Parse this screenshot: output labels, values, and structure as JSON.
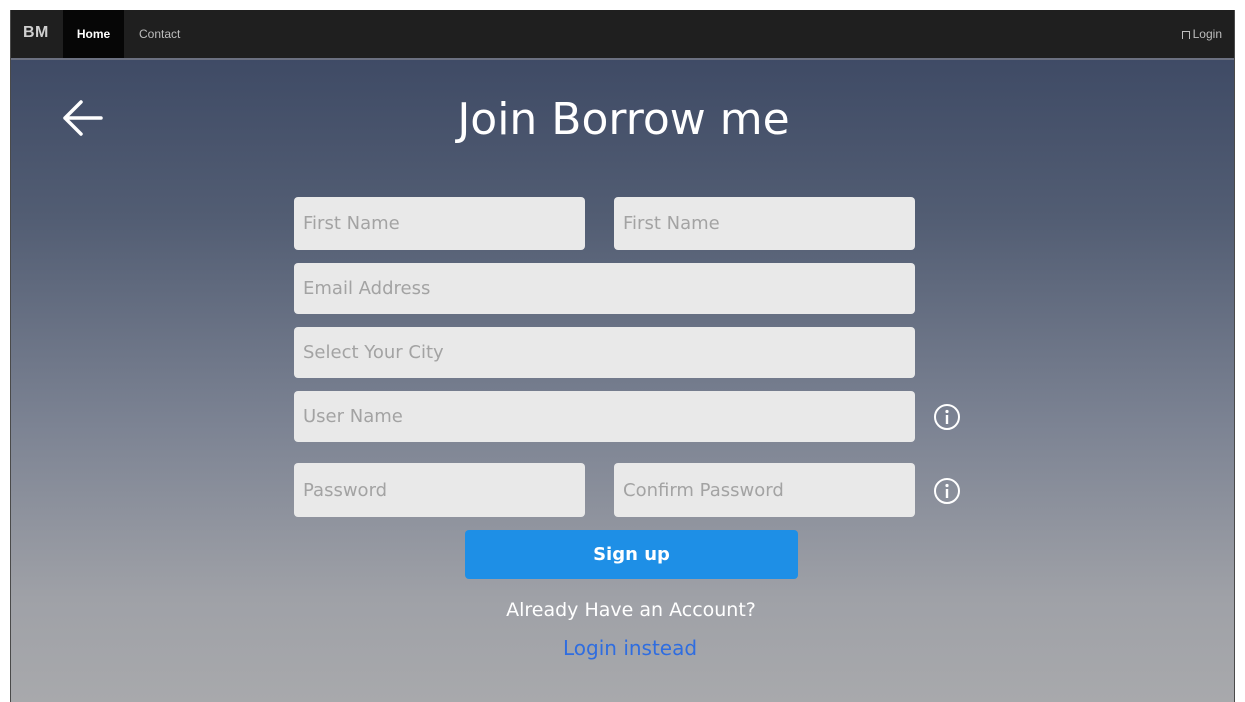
{
  "nav": {
    "brand": "BM",
    "home": "Home",
    "contact": "Contact",
    "login": "Login"
  },
  "page": {
    "title": "Join Borrow me"
  },
  "form": {
    "first_name_placeholder": "First Name",
    "last_name_placeholder": "First Name",
    "email_placeholder": "Email Address",
    "city_placeholder": "Select Your City",
    "username_placeholder": "User Name",
    "password_placeholder": "Password",
    "confirm_password_placeholder": "Confirm Password",
    "signup_label": "Sign up",
    "already_text": "Already Have an Account?",
    "login_instead": "Login instead"
  },
  "icons": {
    "back": "arrow-left-icon",
    "info": "info-icon"
  },
  "colors": {
    "accent": "#1e8fe6",
    "link": "#2f6de0",
    "navbar": "#1f1f1f"
  }
}
